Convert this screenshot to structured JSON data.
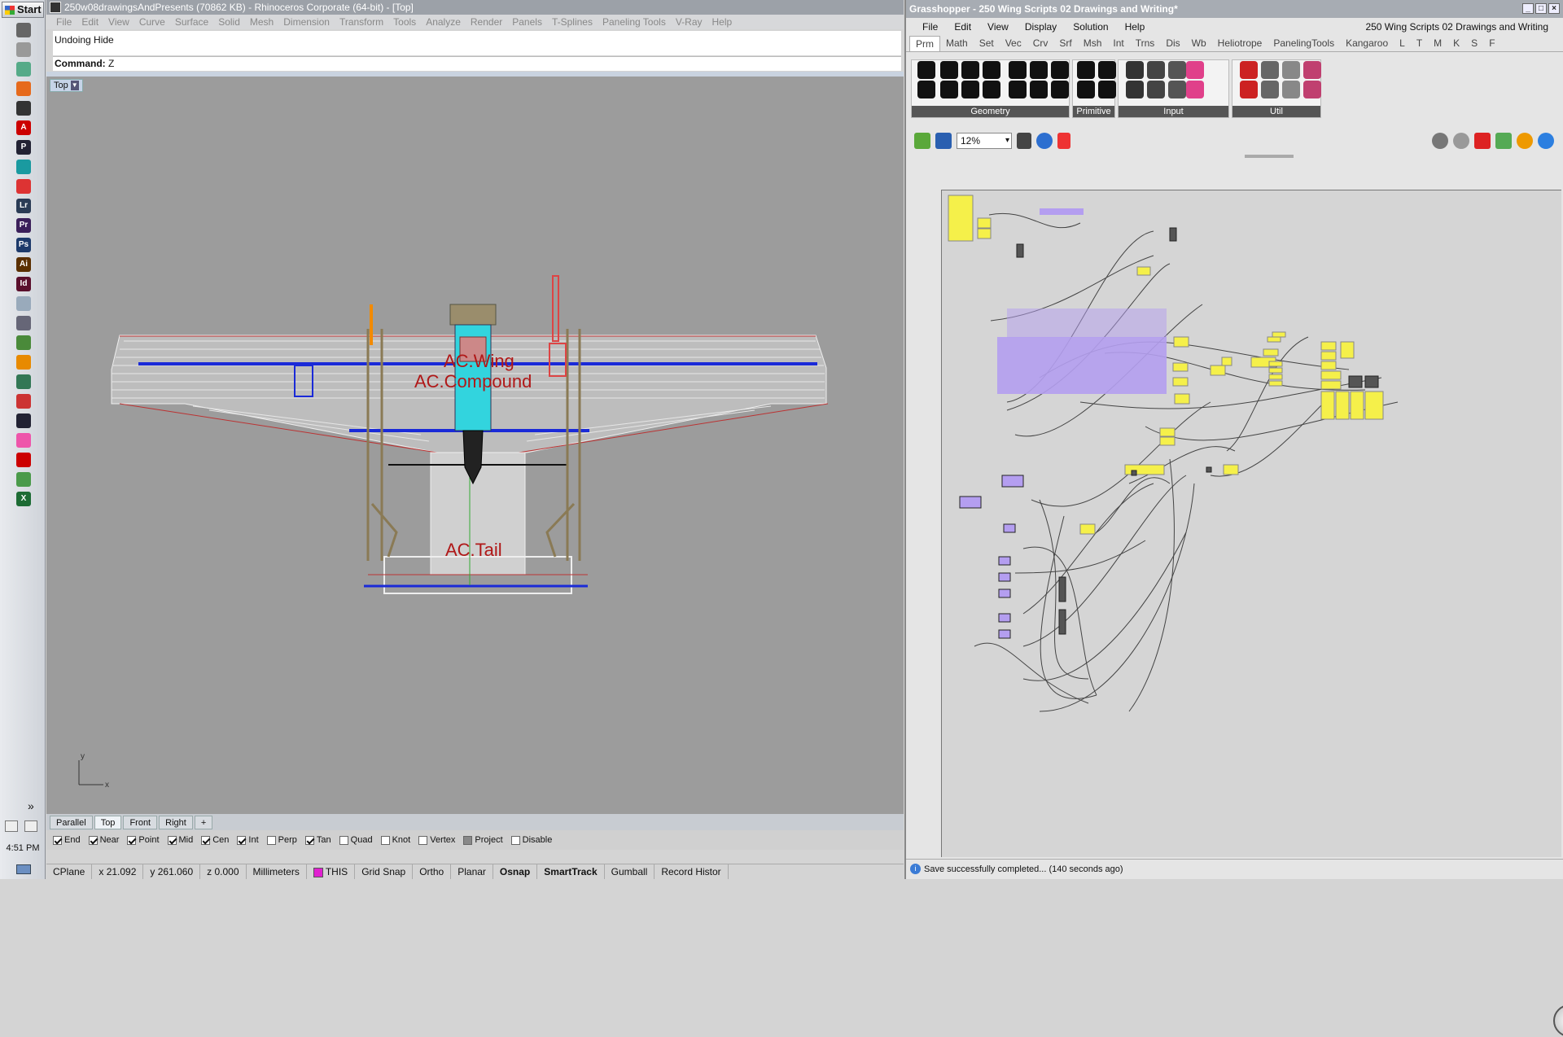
{
  "taskbar": {
    "start_label": "Start",
    "clock": "4:51 PM",
    "apps": [
      {
        "name": "app-icon-1",
        "color": "#666",
        "glyph": ""
      },
      {
        "name": "app-icon-2",
        "color": "#999",
        "glyph": ""
      },
      {
        "name": "app-icon-3",
        "color": "#5a8",
        "glyph": ""
      },
      {
        "name": "firefox-icon",
        "color": "#e66a1c",
        "glyph": ""
      },
      {
        "name": "rhino-icon",
        "color": "#333",
        "glyph": ""
      },
      {
        "name": "acrobat-icon",
        "color": "#c00",
        "glyph": "A"
      },
      {
        "name": "p-app-icon",
        "color": "#223",
        "glyph": "P"
      },
      {
        "name": "arduino-icon",
        "color": "#1a9aa0",
        "glyph": ""
      },
      {
        "name": "shockwave-icon",
        "color": "#d33",
        "glyph": ""
      },
      {
        "name": "lightroom-icon",
        "color": "#2a3b55",
        "glyph": "Lr"
      },
      {
        "name": "premiere-icon",
        "color": "#3b1f5a",
        "glyph": "Pr"
      },
      {
        "name": "photoshop-icon",
        "color": "#1d3a6b",
        "glyph": "Ps"
      },
      {
        "name": "illustrator-icon",
        "color": "#5a2f00",
        "glyph": "Ai"
      },
      {
        "name": "indesign-icon",
        "color": "#5a0f2c",
        "glyph": "Id"
      },
      {
        "name": "notepad-icon",
        "color": "#9ab",
        "glyph": ""
      },
      {
        "name": "network-icon",
        "color": "#667",
        "glyph": ""
      },
      {
        "name": "green-app-icon",
        "color": "#4a8a3a",
        "glyph": ""
      },
      {
        "name": "vlc-icon",
        "color": "#e88a00",
        "glyph": ""
      },
      {
        "name": "monitor-icon",
        "color": "#375",
        "glyph": ""
      },
      {
        "name": "calendar-icon",
        "color": "#c33",
        "glyph": ""
      },
      {
        "name": "eye-icon",
        "color": "#223",
        "glyph": ""
      },
      {
        "name": "pink-app-icon",
        "color": "#e5a",
        "glyph": ""
      },
      {
        "name": "acrobat-reader-icon",
        "color": "#c00",
        "glyph": ""
      },
      {
        "name": "chrome-icon",
        "color": "#4a9a4a",
        "glyph": ""
      },
      {
        "name": "excel-icon",
        "color": "#1d6b34",
        "glyph": "X"
      }
    ]
  },
  "rhino": {
    "title": "250w08drawingsAndPresents (70862 KB) - Rhinoceros Corporate (64-bit) - [Top]",
    "menu": [
      "File",
      "Edit",
      "View",
      "Curve",
      "Surface",
      "Solid",
      "Mesh",
      "Dimension",
      "Transform",
      "Tools",
      "Analyze",
      "Render",
      "Panels",
      "T-Splines",
      "Paneling Tools",
      "V-Ray",
      "Help"
    ],
    "history": "Undoing Hide",
    "command_label": "Command:",
    "command_value": "Z",
    "viewport_label": "Top",
    "viewport_text": [
      "AC.Wing",
      "AC.Compound",
      "AC.Tail"
    ],
    "axis_y": "y",
    "axis_x": "x",
    "view_tabs": [
      "Parallel",
      "Top",
      "Front",
      "Right",
      "+"
    ],
    "active_view_tab": "Top",
    "osnaps": [
      {
        "label": "End",
        "checked": true
      },
      {
        "label": "Near",
        "checked": true
      },
      {
        "label": "Point",
        "checked": true
      },
      {
        "label": "Mid",
        "checked": true
      },
      {
        "label": "Cen",
        "checked": true
      },
      {
        "label": "Int",
        "checked": true
      },
      {
        "label": "Perp",
        "checked": false
      },
      {
        "label": "Tan",
        "checked": true
      },
      {
        "label": "Quad",
        "checked": false
      },
      {
        "label": "Knot",
        "checked": false
      },
      {
        "label": "Vertex",
        "checked": false
      },
      {
        "label": "Project",
        "checked": false,
        "filled": true
      },
      {
        "label": "Disable",
        "checked": false
      }
    ],
    "status": {
      "cplane": "CPlane",
      "x": "x 21.092",
      "y": "y 261.060",
      "z": "z 0.000",
      "units": "Millimeters",
      "layer": "THIS",
      "layer_color": "#e020d0",
      "toggles": [
        {
          "label": "Grid Snap",
          "bold": false
        },
        {
          "label": "Ortho",
          "bold": false
        },
        {
          "label": "Planar",
          "bold": false
        },
        {
          "label": "Osnap",
          "bold": true
        },
        {
          "label": "SmartTrack",
          "bold": true
        },
        {
          "label": "Gumball",
          "bold": false
        },
        {
          "label": "Record Histor",
          "bold": false
        }
      ]
    }
  },
  "grasshopper": {
    "title": "Grasshopper - 250 Wing Scripts 02 Drawings and Writing*",
    "menu": [
      "File",
      "Edit",
      "View",
      "Display",
      "Solution",
      "Help"
    ],
    "doc_name": "250 Wing Scripts 02 Drawings and Writing",
    "tabs": [
      "Prm",
      "Math",
      "Set",
      "Vec",
      "Crv",
      "Srf",
      "Msh",
      "Int",
      "Trns",
      "Dis",
      "Wb",
      "Heliotrope",
      "PanelingTools",
      "Kangaroo",
      "L",
      "T",
      "M",
      "K",
      "S",
      "F"
    ],
    "active_tab": "Prm",
    "groups": [
      "Geometry",
      "Primitive",
      "Input",
      "Util"
    ],
    "zoom": "12%",
    "status_message": "Save successfully completed... (140 seconds ago)",
    "canvas_bg": "#d5d5d5",
    "group_color": "#b49ef0",
    "panel_color": "#f5f04a"
  }
}
